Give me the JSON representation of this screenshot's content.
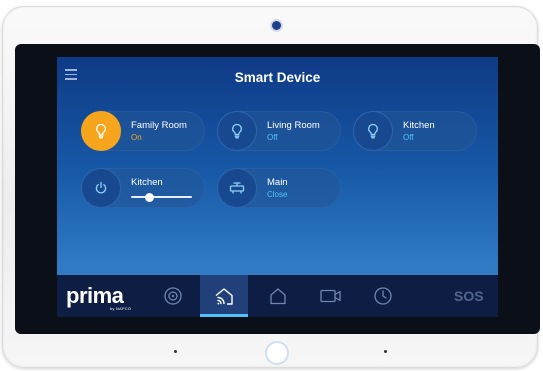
{
  "screen": {
    "title": "Smart Device"
  },
  "devices": [
    {
      "name": "Family Room",
      "state": "On",
      "icon": "bulb-icon",
      "active": true
    },
    {
      "name": "Living Room",
      "state": "Off",
      "icon": "bulb-icon",
      "active": false
    },
    {
      "name": "Kitchen",
      "state": "Off",
      "icon": "bulb-icon",
      "active": false
    },
    {
      "name": "Kitchen",
      "icon": "power-icon",
      "dimmer_level": 0.3
    },
    {
      "name": "Main",
      "state": "Close",
      "icon": "valve-icon"
    }
  ],
  "navbar": {
    "brand": "prima",
    "brand_sub": "by NAPCO",
    "items": [
      {
        "icon": "security-icon",
        "active": false
      },
      {
        "icon": "smart-home-icon",
        "active": true
      },
      {
        "icon": "home-icon",
        "active": false
      },
      {
        "icon": "camera-icon",
        "active": false
      },
      {
        "icon": "clock-icon",
        "active": false
      }
    ],
    "sos_label": "SOS"
  },
  "colors": {
    "accent_orange": "#f6a51c",
    "status_blue": "#4fc3f7",
    "nav_background": "#0e1d44"
  }
}
